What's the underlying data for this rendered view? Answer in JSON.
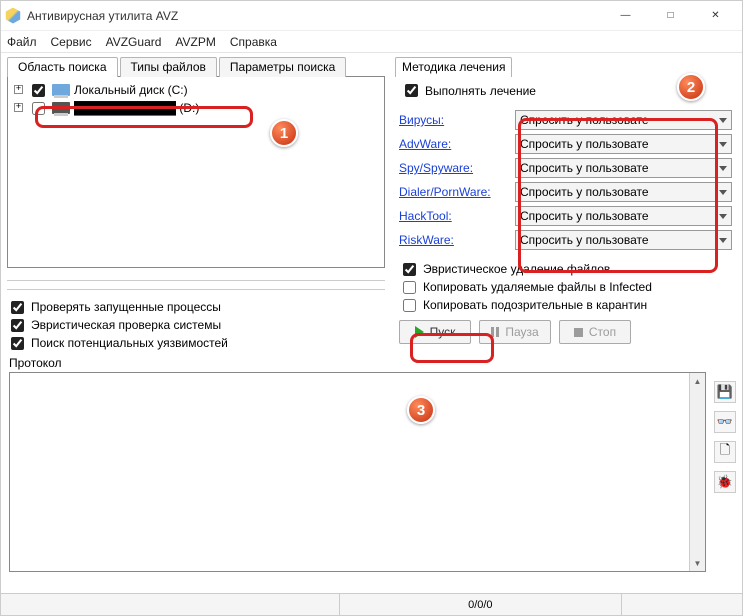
{
  "window": {
    "title": "Антивирусная утилита AVZ",
    "minimize": "—",
    "maximize": "□",
    "close": "✕"
  },
  "menu": {
    "items": [
      "Файл",
      "Сервис",
      "AVZGuard",
      "AVZPM",
      "Справка"
    ]
  },
  "left_tabs": {
    "items": [
      "Область поиска",
      "Типы файлов",
      "Параметры поиска"
    ]
  },
  "tree": {
    "rows": [
      {
        "checked": true,
        "label": "Локальный диск (C:)"
      },
      {
        "checked": false,
        "label": "████████████ (D:)"
      }
    ]
  },
  "left_options": {
    "opt1": {
      "checked": true,
      "label": "Проверять запущенные процессы"
    },
    "opt2": {
      "checked": true,
      "label": "Эвристическая проверка системы"
    },
    "opt3": {
      "checked": true,
      "label": "Поиск потенциальных уязвимостей"
    }
  },
  "right": {
    "section_tab": "Методика лечения",
    "perform_treatment": {
      "checked": true,
      "label": "Выполнять лечение"
    },
    "threats": [
      {
        "name": "Вирусы:",
        "action": "Спросить у пользовате"
      },
      {
        "name": "AdvWare:",
        "action": "Спросить у пользовате"
      },
      {
        "name": "Spy/Spyware:",
        "action": "Спросить у пользовате"
      },
      {
        "name": "Dialer/PornWare:",
        "action": "Спросить у пользовате"
      },
      {
        "name": "HackTool:",
        "action": "Спросить у пользовате"
      },
      {
        "name": "RiskWare:",
        "action": "Спросить у пользовате"
      }
    ],
    "heuristic_delete": {
      "checked": true,
      "label": "Эвристическое удаление файлов"
    },
    "copy_infected": {
      "checked": false,
      "label": "Копировать удаляемые файлы в Infected"
    },
    "copy_quarantine": {
      "checked": false,
      "label": "Копировать подозрительные в карантин"
    }
  },
  "buttons": {
    "start": "Пуск",
    "pause": "Пауза",
    "stop": "Стоп"
  },
  "protocol_label": "Протокол",
  "statusbar": {
    "counts": "0/0/0"
  },
  "side_tools": {
    "save": "💾",
    "glasses": "👓",
    "doc": "🗋",
    "bug": "🐞"
  },
  "annotations": {
    "n1": "1",
    "n2": "2",
    "n3": "3"
  }
}
